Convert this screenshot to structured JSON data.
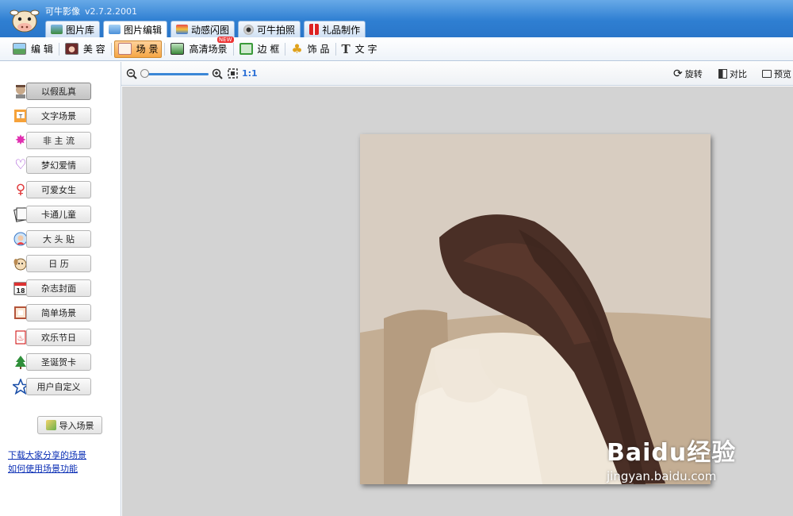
{
  "app": {
    "title": "可牛影像",
    "version": "v2.7.2.2001"
  },
  "main_tabs": [
    {
      "label": "图片库",
      "icon": "gallery-icon",
      "active": false
    },
    {
      "label": "图片编辑",
      "icon": "edit-photo-icon",
      "active": true
    },
    {
      "label": "动感闪图",
      "icon": "animated-icon",
      "active": false
    },
    {
      "label": "可牛拍照",
      "icon": "webcam-icon",
      "active": false
    },
    {
      "label": "礼品制作",
      "icon": "gift-icon",
      "active": false
    }
  ],
  "toolbar": [
    {
      "label": "编 辑",
      "icon": "landscape-icon",
      "active": false
    },
    {
      "label": "美 容",
      "icon": "face-icon",
      "active": false
    },
    {
      "label": "场 景",
      "icon": "scene-icon",
      "active": true
    },
    {
      "label": "高清场景",
      "icon": "hd-scene-icon",
      "active": false,
      "badge": "NEW"
    },
    {
      "label": "边 框",
      "icon": "frame-icon",
      "active": false
    },
    {
      "label": "饰 品",
      "icon": "clover-icon",
      "active": false
    },
    {
      "label": "文 字",
      "icon": "text-icon",
      "active": false
    }
  ],
  "scene_categories": [
    {
      "label": "以假乱真",
      "icon": "portrait-icon",
      "active": true
    },
    {
      "label": "文字场景",
      "icon": "text-scene-icon",
      "active": false
    },
    {
      "label": "非 主 流",
      "icon": "burst-icon",
      "active": false
    },
    {
      "label": "梦幻爱情",
      "icon": "heart-icon",
      "active": false
    },
    {
      "label": "可爱女生",
      "icon": "female-icon",
      "active": false
    },
    {
      "label": "卡通儿童",
      "icon": "book-icon",
      "active": false
    },
    {
      "label": "大 头 贴",
      "icon": "avatar-sticker-icon",
      "active": false
    },
    {
      "label": "日 历",
      "icon": "dog-icon",
      "active": false
    },
    {
      "label": "杂志封面",
      "icon": "calendar-icon",
      "active": false
    },
    {
      "label": "简单场景",
      "icon": "simple-frame-icon",
      "active": false
    },
    {
      "label": "欢乐节日",
      "icon": "spring-festival-icon",
      "active": false
    },
    {
      "label": "圣诞贺卡",
      "icon": "christmas-tree-icon",
      "active": false
    },
    {
      "label": "用户自定义",
      "icon": "star-icon",
      "active": false
    }
  ],
  "calendar_icon_text": "18",
  "import_button": {
    "label": "导入场景",
    "icon": "import-icon"
  },
  "links": {
    "download_shared": "下载大家分享的场景",
    "how_to_use": "如何使用场景功能"
  },
  "zoom": {
    "ratio_label": "1:1",
    "level": 0.0
  },
  "view_tools": {
    "rotate": "旋转",
    "compare": "对比",
    "preview": "预览"
  },
  "watermark": {
    "brand": "Baidu经验",
    "url": "jingyan.baidu.com"
  },
  "colors": {
    "title_bar": "#3a88d8",
    "active_tool": "#f5a645",
    "link": "#0b2fb5",
    "canvas_bg": "#d3d3d3"
  }
}
